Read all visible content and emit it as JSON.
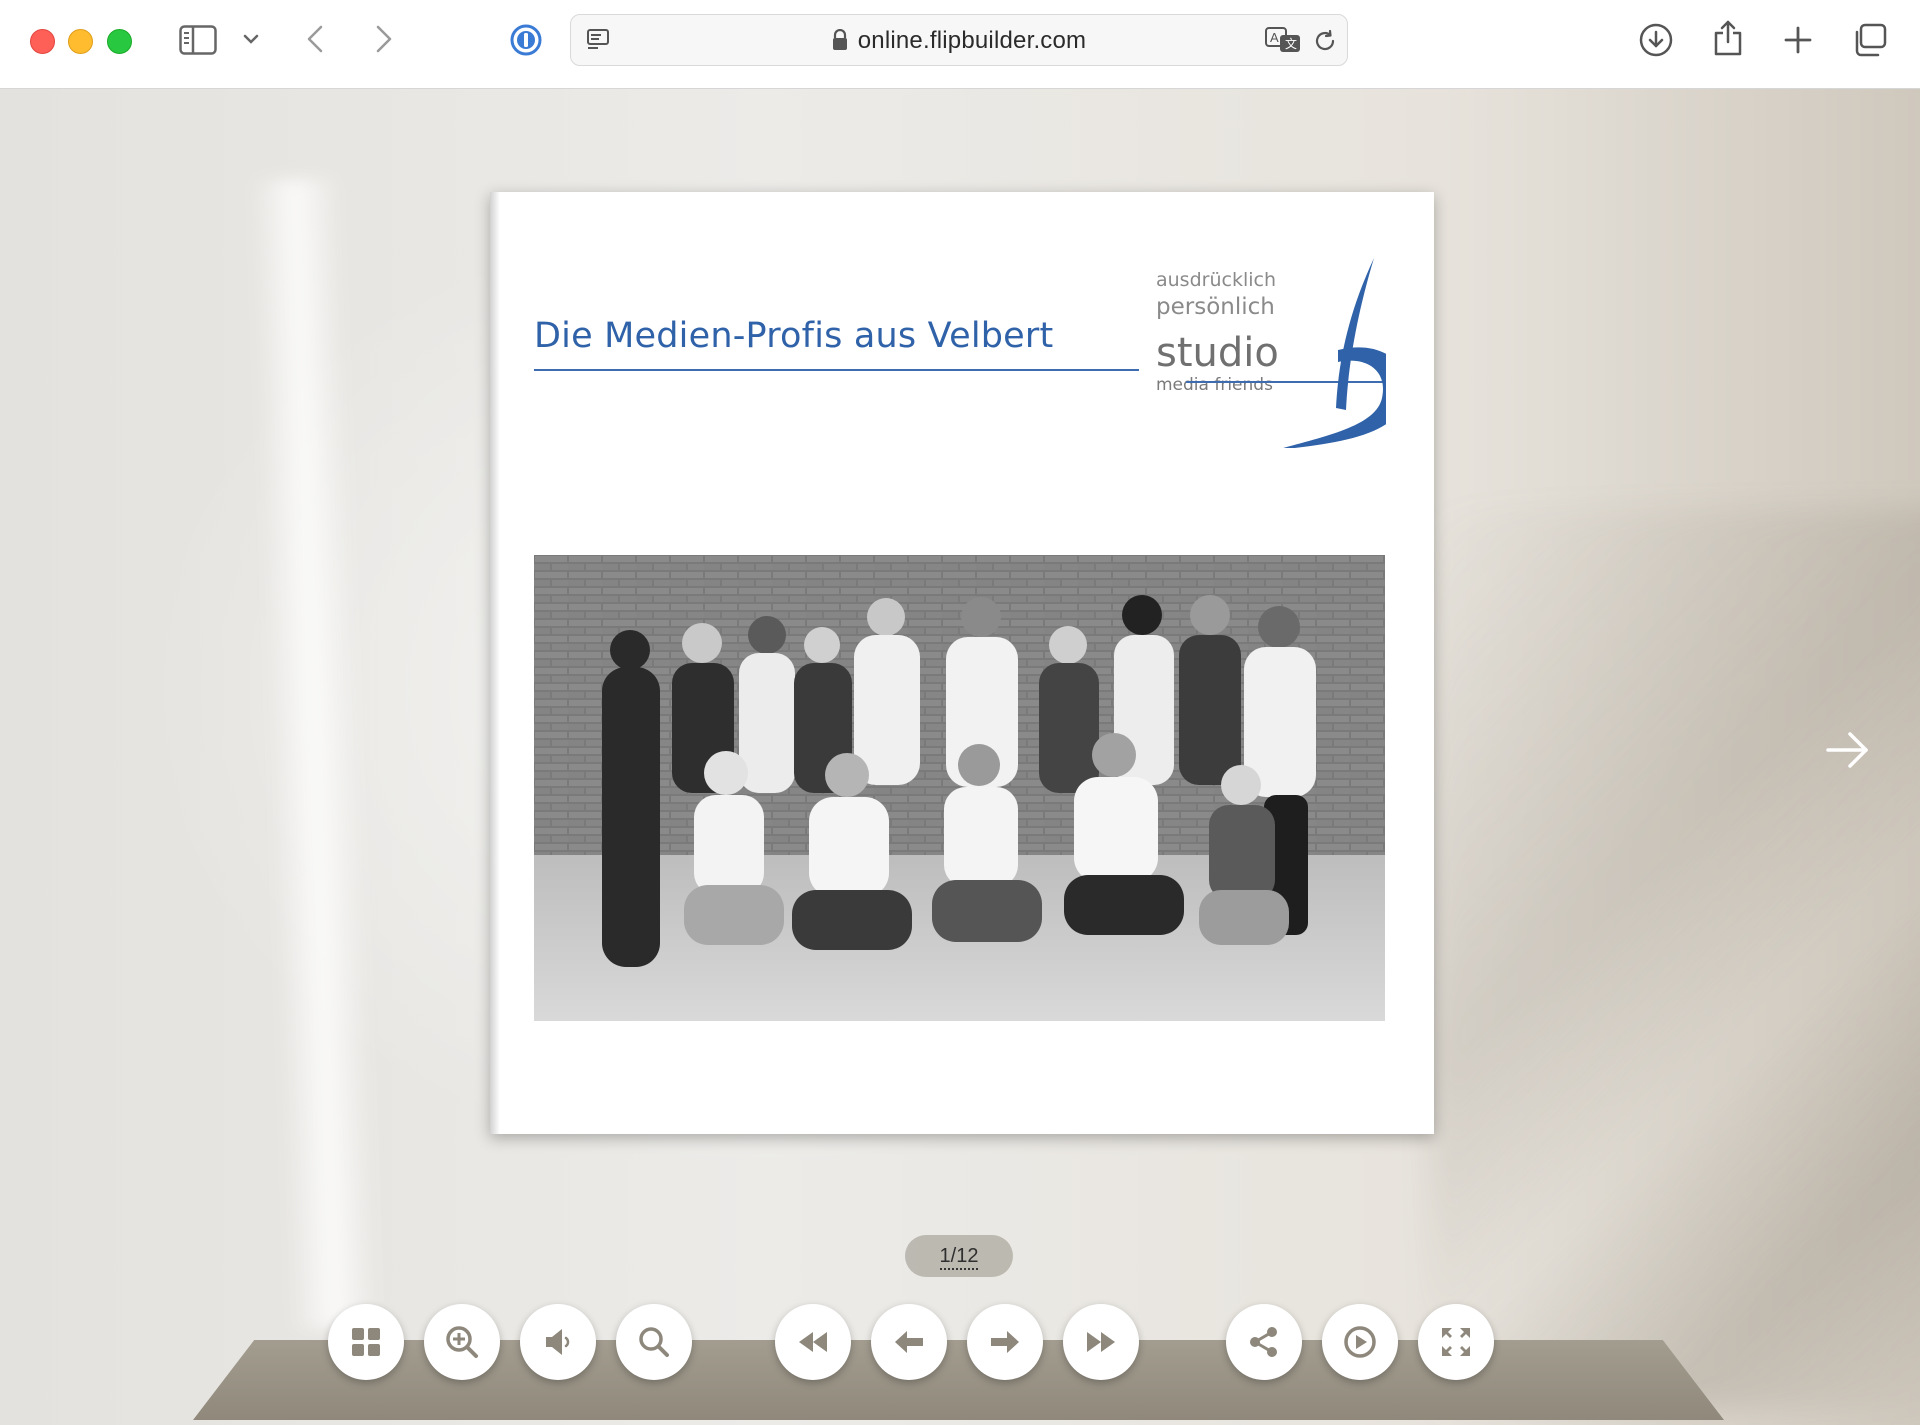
{
  "browser": {
    "url": "online.flipbuilder.com"
  },
  "page": {
    "title": "Die Medien-Profis aus Velbert",
    "logo": {
      "line1": "ausdrücklich",
      "line2": "persönlich",
      "brand": "studio",
      "tagline": "media friends"
    },
    "photo_alt": ""
  },
  "viewer": {
    "page_counter": "1/12",
    "brand_color": "#2f62a8",
    "controls": [
      "thumbnails",
      "zoom-in",
      "sound",
      "search",
      "first-page",
      "previous-page",
      "next-page",
      "last-page",
      "share",
      "autoplay",
      "fullscreen"
    ]
  }
}
